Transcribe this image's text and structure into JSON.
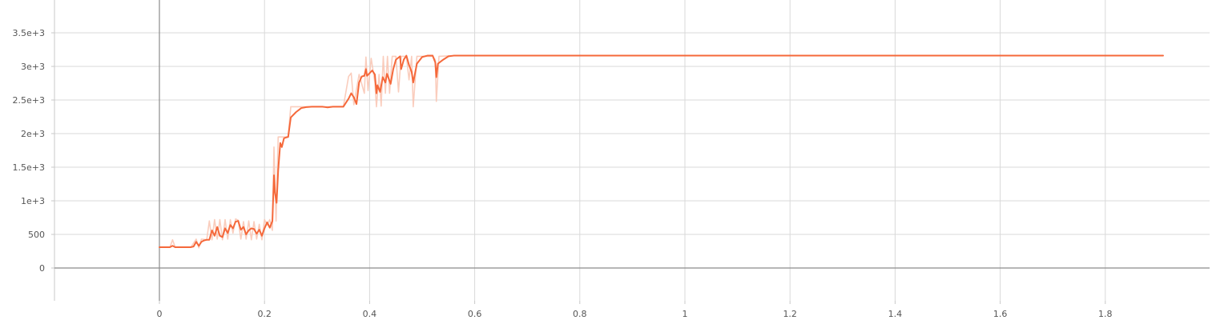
{
  "chart_data": {
    "type": "line",
    "title": "",
    "xlabel": "",
    "ylabel": "",
    "xlim": [
      -0.2,
      1.98
    ],
    "ylim": [
      -500,
      4000
    ],
    "x_ticks": [
      0,
      0.2,
      0.4,
      0.6,
      0.8,
      1,
      1.2,
      1.4,
      1.6,
      1.8
    ],
    "x_tick_labels": [
      "0",
      "0.2",
      "0.4",
      "0.6",
      "0.8",
      "1",
      "1.2",
      "1.4",
      "1.6",
      "1.8"
    ],
    "y_ticks": [
      0,
      500,
      1000,
      1500,
      2000,
      2500,
      3000,
      3500
    ],
    "y_tick_labels": [
      "0",
      "500",
      "1e+3",
      "1.5e+3",
      "2e+3",
      "2.5e+3",
      "3e+3",
      "3.5e+3"
    ],
    "grid": true,
    "colors": {
      "smoothed": "#f5683a",
      "raw": "#f9c4b2"
    },
    "series": [
      {
        "role": "smoothed",
        "points": [
          [
            0,
            310
          ],
          [
            0.02,
            310
          ],
          [
            0.025,
            330
          ],
          [
            0.03,
            310
          ],
          [
            0.06,
            310
          ],
          [
            0.065,
            320
          ],
          [
            0.07,
            390
          ],
          [
            0.075,
            330
          ],
          [
            0.08,
            390
          ],
          [
            0.085,
            410
          ],
          [
            0.09,
            420
          ],
          [
            0.095,
            420
          ],
          [
            0.1,
            560
          ],
          [
            0.105,
            480
          ],
          [
            0.11,
            610
          ],
          [
            0.115,
            480
          ],
          [
            0.12,
            460
          ],
          [
            0.125,
            590
          ],
          [
            0.13,
            520
          ],
          [
            0.135,
            640
          ],
          [
            0.14,
            590
          ],
          [
            0.145,
            690
          ],
          [
            0.15,
            700
          ],
          [
            0.155,
            570
          ],
          [
            0.16,
            610
          ],
          [
            0.165,
            500
          ],
          [
            0.17,
            560
          ],
          [
            0.175,
            590
          ],
          [
            0.18,
            580
          ],
          [
            0.185,
            510
          ],
          [
            0.19,
            570
          ],
          [
            0.195,
            480
          ],
          [
            0.2,
            590
          ],
          [
            0.205,
            680
          ],
          [
            0.21,
            600
          ],
          [
            0.215,
            700
          ],
          [
            0.218,
            1380
          ],
          [
            0.22,
            1120
          ],
          [
            0.223,
            970
          ],
          [
            0.226,
            1450
          ],
          [
            0.23,
            1860
          ],
          [
            0.233,
            1800
          ],
          [
            0.237,
            1930
          ],
          [
            0.24,
            1940
          ],
          [
            0.245,
            1950
          ],
          [
            0.25,
            2240
          ],
          [
            0.26,
            2320
          ],
          [
            0.27,
            2380
          ],
          [
            0.28,
            2395
          ],
          [
            0.29,
            2400
          ],
          [
            0.3,
            2400
          ],
          [
            0.31,
            2400
          ],
          [
            0.315,
            2395
          ],
          [
            0.32,
            2390
          ],
          [
            0.33,
            2400
          ],
          [
            0.35,
            2400
          ],
          [
            0.36,
            2520
          ],
          [
            0.365,
            2600
          ],
          [
            0.37,
            2540
          ],
          [
            0.375,
            2440
          ],
          [
            0.38,
            2760
          ],
          [
            0.385,
            2850
          ],
          [
            0.39,
            2860
          ],
          [
            0.393,
            2960
          ],
          [
            0.395,
            2860
          ],
          [
            0.4,
            2900
          ],
          [
            0.405,
            2940
          ],
          [
            0.41,
            2880
          ],
          [
            0.413,
            2600
          ],
          [
            0.415,
            2720
          ],
          [
            0.42,
            2620
          ],
          [
            0.425,
            2840
          ],
          [
            0.43,
            2760
          ],
          [
            0.433,
            2890
          ],
          [
            0.44,
            2740
          ],
          [
            0.445,
            2960
          ],
          [
            0.45,
            3100
          ],
          [
            0.458,
            3150
          ],
          [
            0.46,
            2960
          ],
          [
            0.465,
            3100
          ],
          [
            0.47,
            3160
          ],
          [
            0.475,
            3020
          ],
          [
            0.48,
            2920
          ],
          [
            0.483,
            2760
          ],
          [
            0.49,
            3040
          ],
          [
            0.5,
            3140
          ],
          [
            0.51,
            3160
          ],
          [
            0.52,
            3160
          ],
          [
            0.525,
            3060
          ],
          [
            0.527,
            2840
          ],
          [
            0.53,
            3040
          ],
          [
            0.54,
            3100
          ],
          [
            0.55,
            3150
          ],
          [
            0.56,
            3160
          ],
          [
            0.58,
            3160
          ],
          [
            0.6,
            3160
          ],
          [
            0.62,
            3160
          ],
          [
            0.8,
            3160
          ],
          [
            1,
            3160
          ],
          [
            1.2,
            3160
          ],
          [
            1.4,
            3160
          ],
          [
            1.6,
            3160
          ],
          [
            1.8,
            3160
          ],
          [
            1.91,
            3160
          ]
        ]
      },
      {
        "role": "raw",
        "points": [
          [
            0,
            310
          ],
          [
            0.02,
            310
          ],
          [
            0.025,
            420
          ],
          [
            0.03,
            310
          ],
          [
            0.06,
            310
          ],
          [
            0.07,
            430
          ],
          [
            0.075,
            300
          ],
          [
            0.08,
            430
          ],
          [
            0.09,
            420
          ],
          [
            0.095,
            700
          ],
          [
            0.1,
            420
          ],
          [
            0.105,
            720
          ],
          [
            0.11,
            430
          ],
          [
            0.115,
            720
          ],
          [
            0.12,
            420
          ],
          [
            0.125,
            720
          ],
          [
            0.13,
            430
          ],
          [
            0.135,
            720
          ],
          [
            0.14,
            520
          ],
          [
            0.145,
            730
          ],
          [
            0.15,
            710
          ],
          [
            0.155,
            430
          ],
          [
            0.16,
            690
          ],
          [
            0.165,
            430
          ],
          [
            0.17,
            700
          ],
          [
            0.175,
            420
          ],
          [
            0.18,
            690
          ],
          [
            0.185,
            430
          ],
          [
            0.19,
            650
          ],
          [
            0.195,
            420
          ],
          [
            0.2,
            720
          ],
          [
            0.205,
            640
          ],
          [
            0.21,
            720
          ],
          [
            0.215,
            560
          ],
          [
            0.218,
            1800
          ],
          [
            0.222,
            700
          ],
          [
            0.226,
            1950
          ],
          [
            0.23,
            1950
          ],
          [
            0.24,
            1950
          ],
          [
            0.245,
            1960
          ],
          [
            0.25,
            2400
          ],
          [
            0.3,
            2400
          ],
          [
            0.35,
            2400
          ],
          [
            0.36,
            2850
          ],
          [
            0.365,
            2900
          ],
          [
            0.37,
            2430
          ],
          [
            0.38,
            2880
          ],
          [
            0.39,
            2600
          ],
          [
            0.393,
            3140
          ],
          [
            0.397,
            2640
          ],
          [
            0.403,
            3120
          ],
          [
            0.41,
            2760
          ],
          [
            0.413,
            2400
          ],
          [
            0.418,
            2880
          ],
          [
            0.422,
            2410
          ],
          [
            0.426,
            3150
          ],
          [
            0.43,
            2600
          ],
          [
            0.434,
            3150
          ],
          [
            0.438,
            2600
          ],
          [
            0.443,
            3150
          ],
          [
            0.45,
            3150
          ],
          [
            0.455,
            2620
          ],
          [
            0.46,
            3150
          ],
          [
            0.47,
            3150
          ],
          [
            0.475,
            2800
          ],
          [
            0.48,
            3150
          ],
          [
            0.483,
            2400
          ],
          [
            0.49,
            3150
          ],
          [
            0.52,
            3150
          ],
          [
            0.525,
            3100
          ],
          [
            0.527,
            2480
          ],
          [
            0.532,
            3150
          ],
          [
            0.56,
            3160
          ],
          [
            0.6,
            3160
          ],
          [
            1,
            3160
          ],
          [
            1.5,
            3160
          ],
          [
            1.91,
            3160
          ]
        ]
      }
    ]
  }
}
